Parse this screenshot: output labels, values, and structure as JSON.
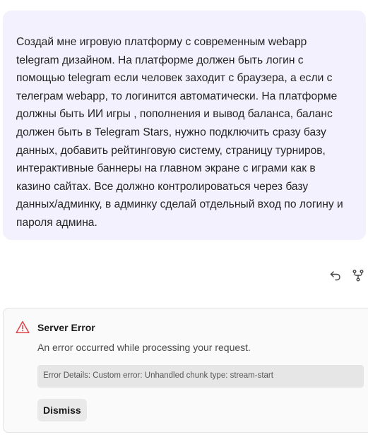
{
  "user_message": {
    "text": "Создай мне игровую платформу с современным webapp\ntelegram дизайном. На платформе должен быть логин с\nпомощью telegram если человек заходит с браузера, а если с\nтелеграм webapp, то логинится автоматически. На платформе\nдолжны быть ИИ игры , пополнения и вывод баланса, баланс\nдолжен быть в Telegram Stars, нужно подключить сразу базу\nданных, добавить рейтинговую систему, страницу турниров,\nинтерактивные баннеры на главном экране с играми как в\nказино сайтах. Все должно контролироваться через базу\nданных/админку, в админку сделай отдельный вход по логину и\nпароля админа."
  },
  "actions": {
    "undo_icon": "undo-icon",
    "branch_icon": "branch-icon"
  },
  "error": {
    "title": "Server Error",
    "description": "An error occurred while processing your request.",
    "details": "Error Details: Custom error: Unhandled chunk type: stream-start",
    "dismiss_label": "Dismiss",
    "icon": "warning-icon",
    "accent_color": "#e0444b"
  }
}
